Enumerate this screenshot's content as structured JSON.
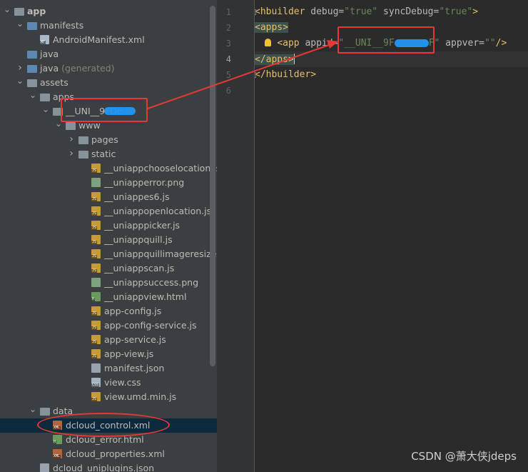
{
  "project_tree": {
    "items": [
      {
        "label": "app",
        "depth": 0,
        "expanded": true,
        "icon": "folder",
        "bold": true
      },
      {
        "label": "manifests",
        "depth": 1,
        "expanded": true,
        "icon": "folder-blue"
      },
      {
        "label": "AndroidManifest.xml",
        "depth": 2,
        "icon": "file-manifest",
        "tag": "MF"
      },
      {
        "label": "java",
        "depth": 1,
        "icon": "folder-blue"
      },
      {
        "label": "java",
        "suffix": " (generated)",
        "depth": 1,
        "expanded": false,
        "icon": "folder-generated"
      },
      {
        "label": "assets",
        "depth": 1,
        "expanded": true,
        "icon": "folder"
      },
      {
        "label": "apps",
        "depth": 2,
        "expanded": true,
        "icon": "folder"
      },
      {
        "label": "__UNI__9FDEE8F",
        "depth": 3,
        "expanded": true,
        "icon": "folder",
        "redacted": true
      },
      {
        "label": "www",
        "depth": 4,
        "expanded": true,
        "icon": "folder"
      },
      {
        "label": "pages",
        "depth": 5,
        "expanded": false,
        "icon": "folder"
      },
      {
        "label": "static",
        "depth": 5,
        "expanded": false,
        "icon": "folder"
      },
      {
        "label": "__uniappchooselocation.js",
        "depth": 6,
        "icon": "file-js",
        "tag": "JS"
      },
      {
        "label": "__uniapperror.png",
        "depth": 6,
        "icon": "file-png",
        "tag": ""
      },
      {
        "label": "__uniappes6.js",
        "depth": 6,
        "icon": "file-js",
        "tag": "JS"
      },
      {
        "label": "__uniappopenlocation.js",
        "depth": 6,
        "icon": "file-js",
        "tag": "JS"
      },
      {
        "label": "__uniapppicker.js",
        "depth": 6,
        "icon": "file-js",
        "tag": "JS"
      },
      {
        "label": "__uniappquill.js",
        "depth": 6,
        "icon": "file-js",
        "tag": "JS"
      },
      {
        "label": "__uniappquillimageresize.js",
        "depth": 6,
        "icon": "file-js",
        "tag": "JS"
      },
      {
        "label": "__uniappscan.js",
        "depth": 6,
        "icon": "file-js",
        "tag": "JS"
      },
      {
        "label": "__uniappsuccess.png",
        "depth": 6,
        "icon": "file-png",
        "tag": ""
      },
      {
        "label": "__uniappview.html",
        "depth": 6,
        "icon": "file-html",
        "tag": "H"
      },
      {
        "label": "app-config.js",
        "depth": 6,
        "icon": "file-js",
        "tag": "JS"
      },
      {
        "label": "app-config-service.js",
        "depth": 6,
        "icon": "file-js",
        "tag": "JS"
      },
      {
        "label": "app-service.js",
        "depth": 6,
        "icon": "file-js",
        "tag": "JS"
      },
      {
        "label": "app-view.js",
        "depth": 6,
        "icon": "file-js",
        "tag": "JS"
      },
      {
        "label": "manifest.json",
        "depth": 6,
        "icon": "file-json",
        "tag": ""
      },
      {
        "label": "view.css",
        "depth": 6,
        "icon": "file-css",
        "tag": "CSS"
      },
      {
        "label": "view.umd.min.js",
        "depth": 6,
        "icon": "file-js",
        "tag": "JS"
      },
      {
        "label": "data",
        "depth": 2,
        "expanded": true,
        "icon": "folder"
      },
      {
        "label": "dcloud_control.xml",
        "depth": 3,
        "icon": "file-xml",
        "tag": "XML",
        "selected": true
      },
      {
        "label": "dcloud_error.html",
        "depth": 3,
        "icon": "file-html",
        "tag": "H"
      },
      {
        "label": "dcloud_properties.xml",
        "depth": 3,
        "icon": "file-xml",
        "tag": "XML"
      },
      {
        "label": "dcloud_uniplugins.json",
        "depth": 2,
        "icon": "file-json",
        "tag": ""
      }
    ]
  },
  "editor": {
    "line_numbers": [
      "1",
      "2",
      "3",
      "4",
      "5",
      "6"
    ],
    "current_line": "4",
    "lines": {
      "l1": {
        "open": "<hbuilder",
        "a1": " debug=",
        "v1": "\"true\"",
        "a2": " syncDebug=",
        "v2": "\"true\"",
        "close": ">"
      },
      "l2": {
        "tag": "<apps>"
      },
      "l3": {
        "indent": "    ",
        "open": "<app",
        "a1": " appid=",
        "v1a": "\"__UNI__9F",
        "v1b": "F\"",
        "a2": " appver=",
        "v2": "\"\"",
        "close": "/>"
      },
      "l4": {
        "tag": "</apps>"
      },
      "l5": {
        "tag": "</hbuilder>"
      }
    }
  },
  "watermark": "CSDN @萧大侠jdeps",
  "colors": {
    "annotation": "#e53935",
    "redaction": "#2196f3",
    "selection": "#0d293e"
  }
}
